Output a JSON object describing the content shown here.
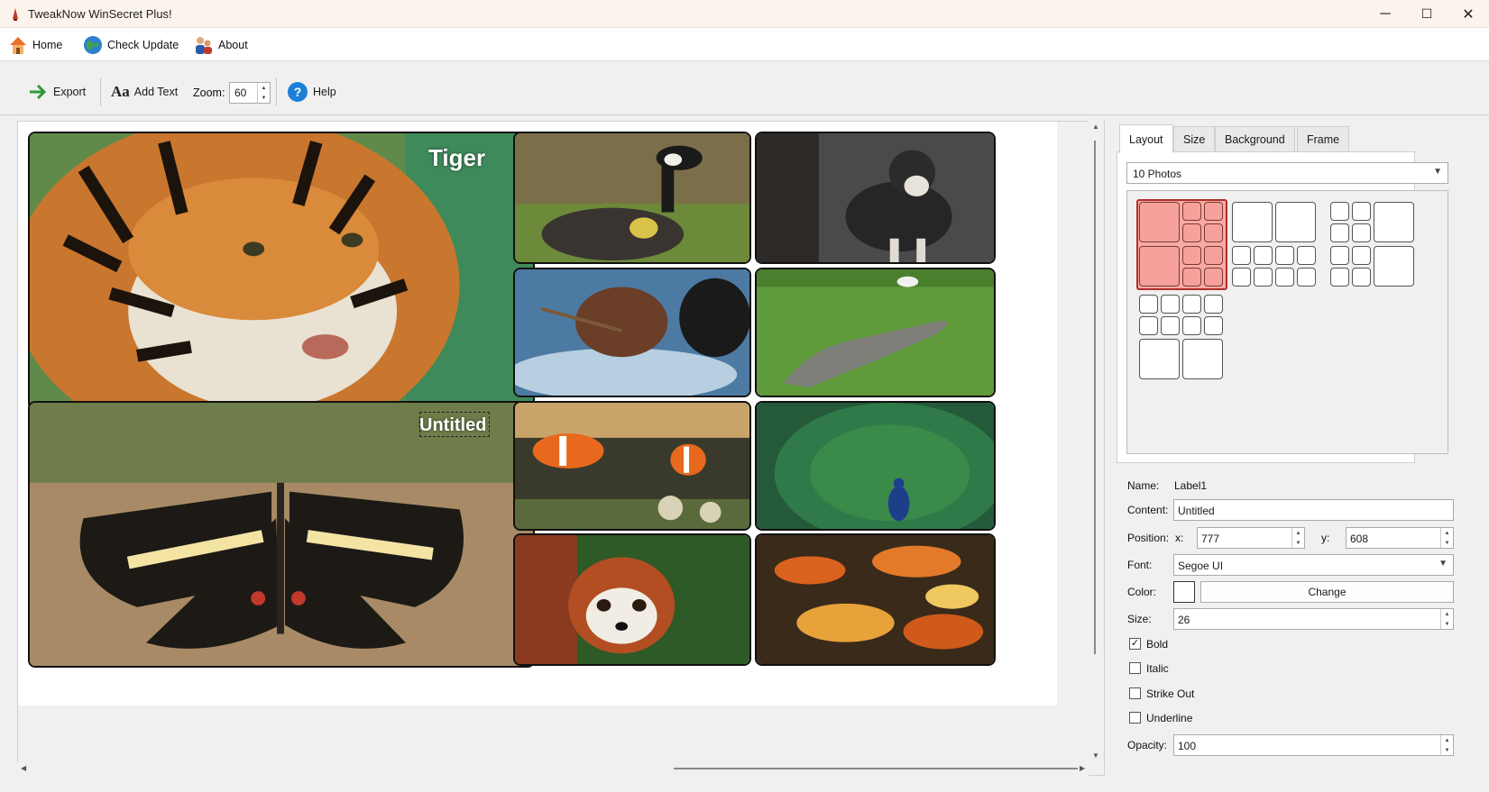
{
  "window": {
    "title": "TweakNow WinSecret Plus!",
    "controls": {
      "minimize": "─",
      "maximize": "☐",
      "close": "✕"
    }
  },
  "menubar": {
    "items": [
      {
        "label": "Home",
        "icon": "home-icon"
      },
      {
        "label": "Check Update",
        "icon": "globe-icon"
      },
      {
        "label": "About",
        "icon": "people-icon"
      }
    ]
  },
  "toolbar": {
    "export_label": "Export",
    "add_text_label": "Add Text",
    "zoom_label": "Zoom:",
    "zoom_value": "60",
    "help_label": "Help"
  },
  "canvas": {
    "photos": [
      {
        "subject": "Tiger",
        "caption": "Tiger"
      },
      {
        "subject": "Canada goose with gosling",
        "caption": ""
      },
      {
        "subject": "Husky dog",
        "caption": ""
      },
      {
        "subject": "Dogs splashing in water",
        "caption": ""
      },
      {
        "subject": "Crocodile on grass",
        "caption": ""
      },
      {
        "subject": "Butterfly",
        "caption": "Untitled"
      },
      {
        "subject": "Clownfish",
        "caption": ""
      },
      {
        "subject": "Peacock",
        "caption": ""
      },
      {
        "subject": "Red panda",
        "caption": ""
      },
      {
        "subject": "Koi fish",
        "caption": ""
      }
    ]
  },
  "panel": {
    "tabs": [
      "Layout",
      "Size",
      "Background",
      "Frame"
    ],
    "active_tab": "Layout",
    "layout_select": "10 Photos"
  },
  "props": {
    "name_label": "Name:",
    "name_value": "Label1",
    "content_label": "Content:",
    "content_value": "Untitled",
    "position_label": "Position:",
    "x_label": "x:",
    "x_value": "777",
    "y_label": "y:",
    "y_value": "608",
    "font_label": "Font:",
    "font_value": "Segoe UI",
    "color_label": "Color:",
    "color_value": "#ffffff",
    "change_label": "Change",
    "size_label": "Size:",
    "size_value": "26",
    "bold_label": "Bold",
    "bold_checked": true,
    "italic_label": "Italic",
    "italic_checked": false,
    "strike_label": "Strike Out",
    "strike_checked": false,
    "underline_label": "Underline",
    "underline_checked": false,
    "opacity_label": "Opacity:",
    "opacity_value": "100"
  }
}
